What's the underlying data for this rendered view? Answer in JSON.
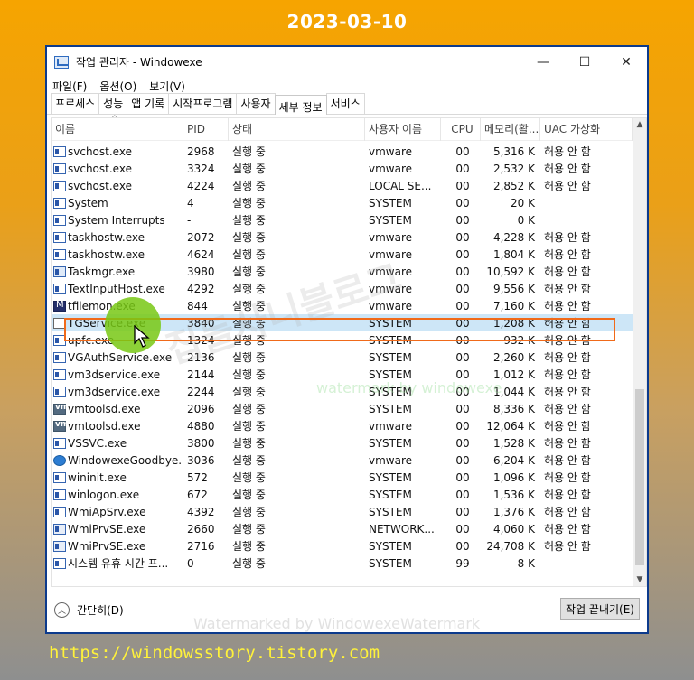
{
  "overlay": {
    "date": "2023-03-10",
    "url": "https://windowsstory.tistory.com",
    "watermark_bottom": "Watermarked by WindowexeWatermark",
    "watermark_mid": "watermark by windowexe",
    "watermark_big": "집들사니블로그"
  },
  "window": {
    "title": "작업 관리자  - Windowexe",
    "minimize": "—",
    "maximize": "☐",
    "close": "✕"
  },
  "menu": [
    "파일(F)",
    "옵션(O)",
    "보기(V)"
  ],
  "tabs": [
    {
      "label": "프로세스",
      "active": false
    },
    {
      "label": "성능",
      "active": false
    },
    {
      "label": "앱 기록",
      "active": false
    },
    {
      "label": "시작프로그램",
      "active": false
    },
    {
      "label": "사용자",
      "active": false
    },
    {
      "label": "세부 정보",
      "active": true
    },
    {
      "label": "서비스",
      "active": false
    }
  ],
  "columns": {
    "name": "이름",
    "pid": "PID",
    "status": "상태",
    "user": "사용자 이름",
    "cpu": "CPU",
    "mem": "메모리(활...",
    "uac": "UAC 가상화"
  },
  "rows": [
    {
      "icon": "app",
      "name": "svchost.exe",
      "pid": "2968",
      "status": "실행 중",
      "user": "vmware",
      "cpu": "00",
      "mem": "5,316 K",
      "uac": "허용 안 함"
    },
    {
      "icon": "app",
      "name": "svchost.exe",
      "pid": "3324",
      "status": "실행 중",
      "user": "vmware",
      "cpu": "00",
      "mem": "2,532 K",
      "uac": "허용 안 함"
    },
    {
      "icon": "app",
      "name": "svchost.exe",
      "pid": "4224",
      "status": "실행 중",
      "user": "LOCAL SE...",
      "cpu": "00",
      "mem": "2,852 K",
      "uac": "허용 안 함"
    },
    {
      "icon": "app",
      "name": "System",
      "pid": "4",
      "status": "실행 중",
      "user": "SYSTEM",
      "cpu": "00",
      "mem": "20 K",
      "uac": ""
    },
    {
      "icon": "app",
      "name": "System Interrupts",
      "pid": "-",
      "status": "실행 중",
      "user": "SYSTEM",
      "cpu": "00",
      "mem": "0 K",
      "uac": ""
    },
    {
      "icon": "app",
      "name": "taskhostw.exe",
      "pid": "2072",
      "status": "실행 중",
      "user": "vmware",
      "cpu": "00",
      "mem": "4,228 K",
      "uac": "허용 안 함"
    },
    {
      "icon": "app",
      "name": "taskhostw.exe",
      "pid": "4624",
      "status": "실행 중",
      "user": "vmware",
      "cpu": "00",
      "mem": "1,804 K",
      "uac": "허용 안 함"
    },
    {
      "icon": "task",
      "name": "Taskmgr.exe",
      "pid": "3980",
      "status": "실행 중",
      "user": "vmware",
      "cpu": "00",
      "mem": "10,592 K",
      "uac": "허용 안 함"
    },
    {
      "icon": "app",
      "name": "TextInputHost.exe",
      "pid": "4292",
      "status": "실행 중",
      "user": "vmware",
      "cpu": "00",
      "mem": "9,556 K",
      "uac": "허용 안 함"
    },
    {
      "icon": "m",
      "name": "tfilemon.exe",
      "pid": "844",
      "status": "실행 중",
      "user": "vmware",
      "cpu": "00",
      "mem": "7,160 K",
      "uac": "허용 안 함"
    },
    {
      "icon": "blank",
      "name": "TGService.exe",
      "pid": "3840",
      "status": "실행 중",
      "user": "SYSTEM",
      "cpu": "00",
      "mem": "1,208 K",
      "uac": "허용 안 함",
      "selected": true
    },
    {
      "icon": "app",
      "name": "upfc.exe",
      "pid": "1324",
      "status": "실행 중",
      "user": "SYSTEM",
      "cpu": "00",
      "mem": "932 K",
      "uac": "허용 안 함"
    },
    {
      "icon": "app",
      "name": "VGAuthService.exe",
      "pid": "2136",
      "status": "실행 중",
      "user": "SYSTEM",
      "cpu": "00",
      "mem": "2,260 K",
      "uac": "허용 안 함"
    },
    {
      "icon": "app",
      "name": "vm3dservice.exe",
      "pid": "2144",
      "status": "실행 중",
      "user": "SYSTEM",
      "cpu": "00",
      "mem": "1,012 K",
      "uac": "허용 안 함"
    },
    {
      "icon": "app",
      "name": "vm3dservice.exe",
      "pid": "2244",
      "status": "실행 중",
      "user": "SYSTEM",
      "cpu": "00",
      "mem": "1,044 K",
      "uac": "허용 안 함"
    },
    {
      "icon": "vm",
      "name": "vmtoolsd.exe",
      "pid": "2096",
      "status": "실행 중",
      "user": "SYSTEM",
      "cpu": "00",
      "mem": "8,336 K",
      "uac": "허용 안 함"
    },
    {
      "icon": "vm",
      "name": "vmtoolsd.exe",
      "pid": "4880",
      "status": "실행 중",
      "user": "vmware",
      "cpu": "00",
      "mem": "12,064 K",
      "uac": "허용 안 함"
    },
    {
      "icon": "app",
      "name": "VSSVC.exe",
      "pid": "3800",
      "status": "실행 중",
      "user": "SYSTEM",
      "cpu": "00",
      "mem": "1,528 K",
      "uac": "허용 안 함"
    },
    {
      "icon": "goodbye",
      "name": "WindowexeGoodbye...",
      "pid": "3036",
      "status": "실행 중",
      "user": "vmware",
      "cpu": "00",
      "mem": "6,204 K",
      "uac": "허용 안 함"
    },
    {
      "icon": "app",
      "name": "wininit.exe",
      "pid": "572",
      "status": "실행 중",
      "user": "SYSTEM",
      "cpu": "00",
      "mem": "1,096 K",
      "uac": "허용 안 함"
    },
    {
      "icon": "app",
      "name": "winlogon.exe",
      "pid": "672",
      "status": "실행 중",
      "user": "SYSTEM",
      "cpu": "00",
      "mem": "1,536 K",
      "uac": "허용 안 함"
    },
    {
      "icon": "app",
      "name": "WmiApSrv.exe",
      "pid": "4392",
      "status": "실행 중",
      "user": "SYSTEM",
      "cpu": "00",
      "mem": "1,376 K",
      "uac": "허용 안 함"
    },
    {
      "icon": "wmi",
      "name": "WmiPrvSE.exe",
      "pid": "2660",
      "status": "실행 중",
      "user": "NETWORK...",
      "cpu": "00",
      "mem": "4,060 K",
      "uac": "허용 안 함"
    },
    {
      "icon": "wmi",
      "name": "WmiPrvSE.exe",
      "pid": "2716",
      "status": "실행 중",
      "user": "SYSTEM",
      "cpu": "00",
      "mem": "24,708 K",
      "uac": "허용 안 함"
    },
    {
      "icon": "app",
      "name": "시스템 유휴 시간 프...",
      "pid": "0",
      "status": "실행 중",
      "user": "SYSTEM",
      "cpu": "99",
      "mem": "8 K",
      "uac": ""
    }
  ],
  "footer": {
    "fewer_details": "간단히(D)",
    "fewer_icon": "chevron-up-icon",
    "end_task": "작업 끝내기(E)"
  }
}
